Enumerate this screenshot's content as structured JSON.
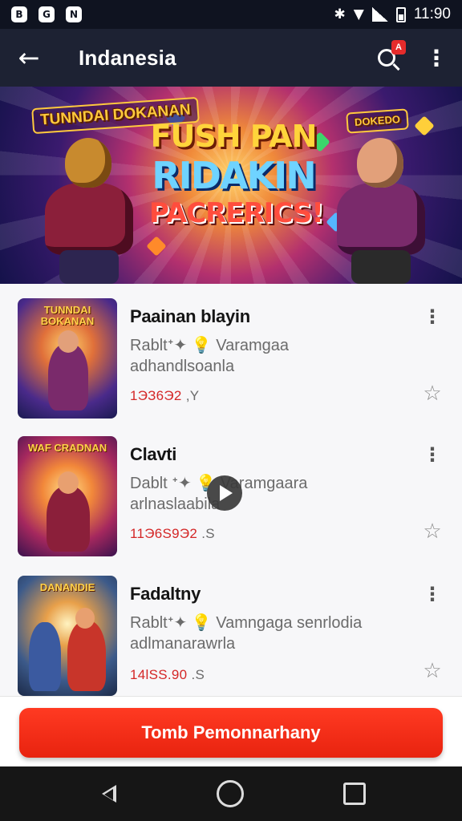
{
  "status_bar": {
    "time": "11:90",
    "notification_icons": [
      "B",
      "G",
      "N"
    ]
  },
  "app_bar": {
    "title": "Indanesia",
    "search_badge": "A"
  },
  "banner": {
    "logo_text": "TUNNDAI DOKANAN",
    "logo2_text": "DOKEDO",
    "title_line1": "FUSH PAN",
    "title_line2": "RIDAKIN",
    "title_line3": "PACRERICS!"
  },
  "items": [
    {
      "thumb_label": "TUNNDAI BOKANAN",
      "title": "Paainan blayin",
      "desc_line1": "Rabltᐩ✦ 💡 Varamgaa",
      "desc_line2": "adhandlsoanla",
      "price": "1ЭЗ6Э2",
      "price_tail": ",Y"
    },
    {
      "thumb_label": "WAF CRADNAN",
      "title": "Clavti",
      "desc_line1": "Dablt ᐩ✦ 💡 Varamgaara",
      "desc_line2": "arlnaslaabila",
      "price": "11Э6Ѕ9Э2",
      "price_tail": ".Ѕ"
    },
    {
      "thumb_label": "DANANDIE",
      "title": "Fadaltny",
      "desc_line1": "Rabltᐩ✦ 💡 Vamngaga senrlodia",
      "desc_line2": "adlmanarawrla",
      "price": "14lЅЅ.90",
      "price_tail": ".Ѕ"
    }
  ],
  "cta_label": "Tomb Pemonnarhany",
  "colors": {
    "accent": "#e8230f",
    "app_bar": "#1d2233",
    "price": "#d42727"
  },
  "icons": {
    "back": "arrow-left-icon",
    "search": "search-icon",
    "overflow": "more-vert-icon",
    "favorite": "star-outline-icon",
    "play": "play-icon"
  }
}
